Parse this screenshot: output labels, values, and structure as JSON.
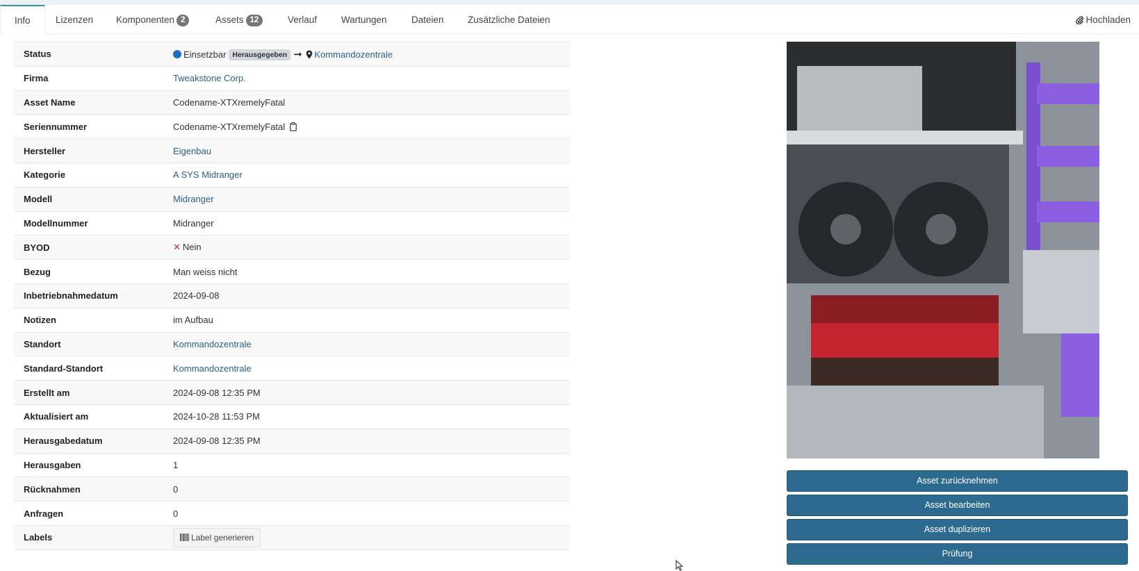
{
  "tabs": [
    {
      "label": "Info"
    },
    {
      "label": "Lizenzen"
    },
    {
      "label": "Komponenten",
      "badge": "2"
    },
    {
      "label": "Assets",
      "badge": "12"
    },
    {
      "label": "Verlauf"
    },
    {
      "label": "Wartungen"
    },
    {
      "label": "Dateien"
    },
    {
      "label": "Zusätzliche Dateien"
    }
  ],
  "upload_label": "Hochladen",
  "fields": {
    "status": {
      "label": "Status",
      "value": "Einsetzbar",
      "tag": "Herausgegeben",
      "location": "Kommandozentrale",
      "dot_color": "#1e6fc4"
    },
    "firma": {
      "label": "Firma",
      "value": "Tweakstone Corp."
    },
    "asset_name": {
      "label": "Asset Name",
      "value": "Codename-XTXremelyFatal"
    },
    "seriennummer": {
      "label": "Seriennummer",
      "value": "Codename-XTXremelyFatal"
    },
    "hersteller": {
      "label": "Hersteller",
      "value": "Eigenbau"
    },
    "kategorie": {
      "label": "Kategorie",
      "value": "A SYS Midranger"
    },
    "modell": {
      "label": "Modell",
      "value": "Midranger"
    },
    "modellnummer": {
      "label": "Modellnummer",
      "value": "Midranger"
    },
    "byod": {
      "label": "BYOD",
      "value": "Nein"
    },
    "bezug": {
      "label": "Bezug",
      "value": "Man weiss nicht"
    },
    "inbetriebnahmedatum": {
      "label": "Inbetriebnahmedatum",
      "value": "2024-09-08"
    },
    "notizen": {
      "label": "Notizen",
      "value": "im Aufbau"
    },
    "standort": {
      "label": "Standort",
      "value": "Kommandozentrale"
    },
    "standard_standort": {
      "label": "Standard-Standort",
      "value": "Kommandozentrale"
    },
    "erstellt_am": {
      "label": "Erstellt am",
      "value": "2024-09-08 12:35 PM"
    },
    "aktualisiert_am": {
      "label": "Aktualisiert am",
      "value": "2024-10-28 11:53 PM"
    },
    "herausgabedatum": {
      "label": "Herausgabedatum",
      "value": "2024-09-08 12:35 PM"
    },
    "herausgaben": {
      "label": "Herausgaben",
      "value": "1"
    },
    "ruecknahmen": {
      "label": "Rücknahmen",
      "value": "0"
    },
    "anfragen": {
      "label": "Anfragen",
      "value": "0"
    },
    "labels": {
      "label": "Labels",
      "button": "Label generieren"
    }
  },
  "actions": {
    "checkin": "Asset zurücknehmen",
    "edit": "Asset bearbeiten",
    "duplicate": "Asset duplizieren",
    "audit": "Prüfung"
  },
  "colors": {
    "accent": "#3c8dbc",
    "link": "#2b5f8a",
    "button": "#2d6a8f"
  }
}
